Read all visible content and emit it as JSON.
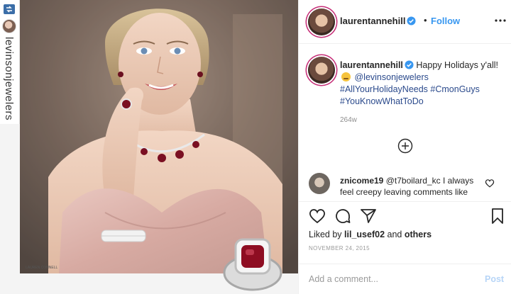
{
  "repost": {
    "account": "levinsonjewelers",
    "icon": "repost-icon"
  },
  "photo": {
    "credit": "LAUREN CONNELL"
  },
  "header": {
    "username": "laurentannehill",
    "separator": "•",
    "follow_label": "Follow",
    "more_icon": "more-options-icon"
  },
  "caption": {
    "username": "laurentannehill",
    "text_1": "Happy Holidays y'all!",
    "mention": "@levinsonjewelers",
    "hashtags": "#AllYourHolidayNeeds #CmonGuys #YouKnowWhatToDo",
    "time_ago": "264w"
  },
  "comments": {
    "load_more_icon": "plus-circle-icon",
    "items": [
      {
        "username": "znicome19",
        "mention": "@t7boilard_kc",
        "text": "I always feel creepy leaving comments like"
      }
    ]
  },
  "likes": {
    "prefix": "Liked by",
    "user": "lil_usef02",
    "joiner": "and",
    "others": "others"
  },
  "post_date": "NOVEMBER 24, 2015",
  "add_comment": {
    "placeholder": "Add a comment...",
    "post_label": "Post"
  },
  "colors": {
    "link": "#3897f0",
    "hashtag": "#2b4a8c",
    "story_ring": "#c62f78",
    "post_disabled": "#b7d5f7"
  }
}
